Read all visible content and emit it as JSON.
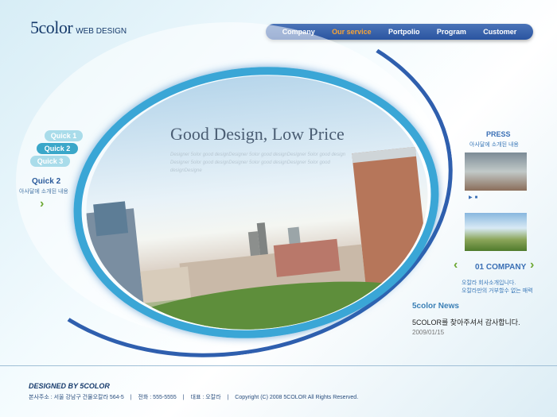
{
  "logo": {
    "main": "5color",
    "sub": "WEB DESIGN"
  },
  "nav": [
    "Company",
    "Our service",
    "Portpolio",
    "Program",
    "Customer"
  ],
  "hero": {
    "headline": "Good Design, Low Price",
    "subline": "Designer 5olor good designDesigner 5olor good designDesigner 5olor good design Designer 5olor good designDesigner 5olor good designDesigner 5olor good designDesigne"
  },
  "quick": {
    "buttons": [
      "Quick 1",
      "Quick 2",
      "Quick 3"
    ],
    "title": "Quick 2",
    "desc": "아사달에 소개된 내용",
    "arrow": "›"
  },
  "press": {
    "title": "PRESS",
    "desc": "아사달에 소개된 내용"
  },
  "company": {
    "title": "01 COMPANY",
    "prev": "‹",
    "next": "›",
    "line1": "오칼라 회사소개입니다.",
    "line2": "오칼라만의 거부할수 없는 매력"
  },
  "news": {
    "title": "5color News",
    "text": "5COLOR를 찾아주셔서 감사합니다.",
    "date": "2009/01/15"
  },
  "footer": {
    "title": "DESIGNED BY 5COLOR",
    "address": "본사주소 : 서울 강남구 건물오칼라 564-5",
    "phone": "전화 : 555-5555",
    "ceo": "대표 : 오칼라",
    "copyright": "Copyright (C) 2008 5COLOR All Rights Reserved.",
    "sep": "|"
  }
}
